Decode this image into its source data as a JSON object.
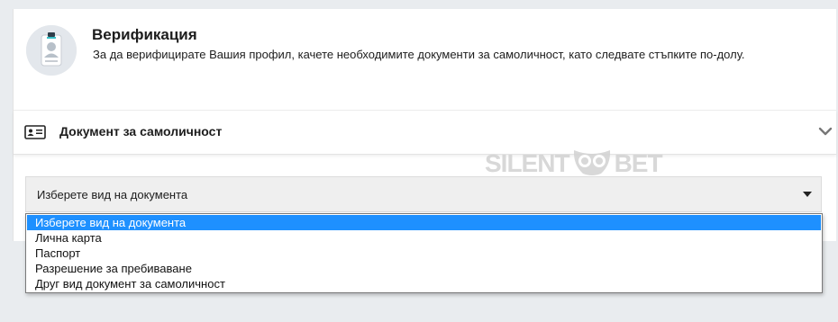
{
  "verification": {
    "title": "Верификация",
    "description": "За да верифицирате Вашия профил, качете необходимите документи за самоличност, като следвате стъпките по-долу.",
    "avatar_icon": "id-badge-icon"
  },
  "section": {
    "title": "Документ за самоличност",
    "icon": "id-card-icon",
    "expand_icon": "chevron-down-icon"
  },
  "watermark": {
    "text_left": "SILENT",
    "text_right": "BET"
  },
  "document_select": {
    "selected_value": "Изберете вид на документа",
    "options": [
      "Изберете вид на документа",
      "Лична карта",
      "Паспорт",
      "Разрешение за пребиваване",
      "Друг вид документ за самоличност"
    ]
  },
  "colors": {
    "highlight": "#1e90ff",
    "background": "#e9ecef",
    "card": "#ffffff"
  }
}
